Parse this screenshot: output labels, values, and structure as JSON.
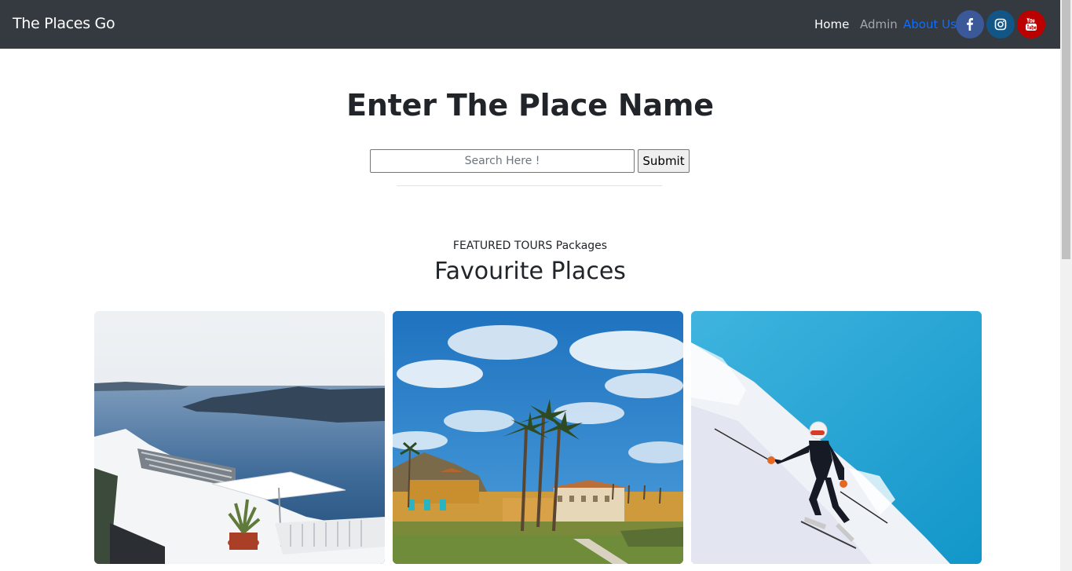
{
  "navbar": {
    "brand": "The Places Go",
    "links": [
      {
        "label": "Home"
      },
      {
        "label": "Admin"
      },
      {
        "label": "About Us"
      }
    ],
    "social": [
      {
        "icon": "facebook-icon",
        "color": "#3b5998"
      },
      {
        "icon": "instagram-icon",
        "color": "#125688"
      },
      {
        "icon": "youtube-icon",
        "color": "#bb0000"
      }
    ]
  },
  "search": {
    "title": "Enter The Place Name",
    "placeholder": "Search Here !",
    "value": "",
    "submit_label": "Submit"
  },
  "featured": {
    "eyebrow": "FEATURED TOURS Packages",
    "title": "Favourite Places",
    "cards": [
      {
        "image": "santorini-seaside-photo"
      },
      {
        "image": "palm-resort-photo"
      },
      {
        "image": "skier-slope-photo"
      }
    ]
  },
  "colors": {
    "navbar_bg": "#343a40",
    "accent": "#0d6efd"
  }
}
